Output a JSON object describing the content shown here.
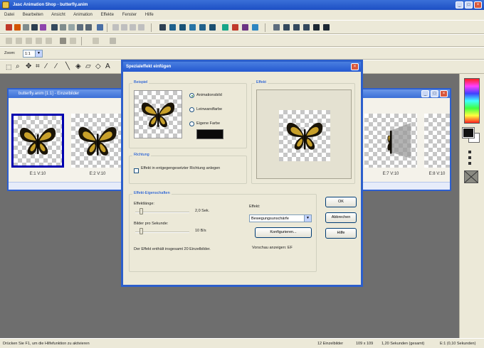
{
  "app": {
    "title": "Jasc Animation Shop - butterfly.anim"
  },
  "menu": [
    "Datei",
    "Bearbeiten",
    "Ansicht",
    "Animation",
    "Effekte",
    "Fenster",
    "Hilfe"
  ],
  "toolbar": {
    "zoom_label": "Zoom:",
    "zoom_value": "1:1"
  },
  "frames_window": {
    "title": "butterfly.anim [1:1] - Einzelbilder",
    "frames": [
      {
        "label": "E:1  V:10"
      },
      {
        "label": "E:2  V:10"
      },
      {
        "label": "E:7  V:10"
      },
      {
        "label": "E:8  V:10"
      }
    ]
  },
  "dialog": {
    "title": "Spezialeffekt einfügen",
    "sample": {
      "group": "Beispiel",
      "options": [
        "Animationsbild",
        "Leinwandfarbe",
        "Eigene Farbe"
      ],
      "selected_index": 0,
      "custom_color": "#0a0a0a"
    },
    "effect_group": "Effekt",
    "direction": {
      "group": "Richtung",
      "checkbox_label": "Effekt in entgegengesetzter Richtung anlegen"
    },
    "properties": {
      "group": "Effekt-Eigenschaften",
      "length_label": "Effektlänge:",
      "length_value": "2,0 Sek.",
      "length_fraction": 0.1,
      "fps_label": "Bilder pro Sekunde:",
      "fps_value": "10 B/s",
      "fps_fraction": 0.1,
      "summary": "Der Effekt enthält insgesamt 20 Einzelbilder."
    },
    "effect": {
      "label": "Effekt:",
      "selected": "Bewegungsunschärfe",
      "configure_button": "Konfigurieren...",
      "preview_toggle": "Vorschau anzeigen: EF"
    },
    "buttons": {
      "ok": "OK",
      "cancel": "Abbrechen",
      "help": "Hilfe"
    }
  },
  "statusbar": {
    "hint": "Drücken Sie F1, um die Hilfefunktion zu aktivieren",
    "frames": "12 Einzelbilder",
    "size": "109 x 109",
    "duration": "1,20 Sekunden (gesamt)",
    "position": "E:1 (0,10 Sekunden)"
  },
  "colors": {
    "title_blue": "#2458d0",
    "selection_frame": "#0000b0",
    "butterfly_body": "#1a1408",
    "butterfly_wing": "#c8a02a"
  }
}
